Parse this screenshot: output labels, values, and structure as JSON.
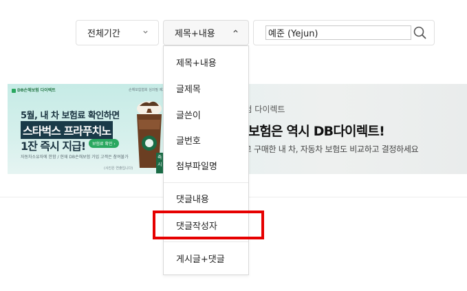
{
  "search": {
    "period_label": "전체기간",
    "scope_label": "제목+내용",
    "query_value": "예준 (Yejun)",
    "icons": {
      "period_chevron": "chevron-down-icon",
      "scope_chevron": "chevron-up-icon",
      "search": "search-icon"
    }
  },
  "dropdown": {
    "items": [
      {
        "label": "제목+내용"
      },
      {
        "label": "글제목"
      },
      {
        "label": "글쓴이"
      },
      {
        "label": "글번호"
      },
      {
        "label": "첨부파일명"
      },
      {
        "label": "댓글내용"
      },
      {
        "label": "댓글작성자"
      },
      {
        "label": "게시글+댓글"
      }
    ],
    "highlighted_item": "댓글작성자",
    "highlight_color": "#e60000"
  },
  "banner": {
    "logo_text": "DB손해보험 다이렉트",
    "promo_line1": "5월, 내 차 보험료 확인하면",
    "promo_line2": "스타벅스 프라푸치노",
    "promo_line3": "1잔 즉시 지급!",
    "promo_pill": "보험료 확인 ›",
    "promo_fine": "자동차소유자에 한함 / 현재 DB손해보험 가입 고객은 참여불가",
    "promo_fine2": "(사진은 연출입니다)",
    "promo_top_small": "손해보험협회 심의필 제2023-",
    "sub_text": "...험 다이렉트",
    "headline": "차보험은 역시 DB다이렉트!",
    "description": "하고 구매한 내 차, 자동차 보험도 비교하고 결정하세요",
    "cup_badge": "즉시"
  }
}
